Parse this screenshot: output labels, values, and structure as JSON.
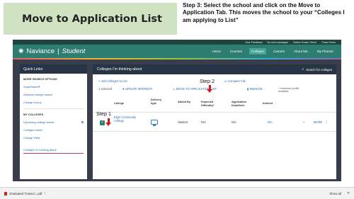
{
  "slide": {
    "title": "Move to Application List",
    "instruction": "Step 3: Select the school and click on the Move to Application Tab. This moves the school to your “Colleges I am applying to List”",
    "step1_label": "Step 1",
    "step2_label": "Step 2"
  },
  "utility_bar": {
    "feedback": "Give Feedback",
    "messages": "No new messages",
    "switch_grade": "Switch Grade: Demo",
    "close_demo": "Close Demo"
  },
  "navbar": {
    "brand": "Naviance",
    "product": "Student",
    "links": [
      "Home",
      "Courses",
      "Colleges",
      "Careers",
      "About Me",
      "My Planner"
    ],
    "active_link": "Colleges"
  },
  "sidebar": {
    "title": "Quick Links",
    "more_search_heading": "MORE SEARCH OPTIONS",
    "search_items": [
      "SuperMatch®",
      "Advance college search",
      "College lookup"
    ],
    "my_colleges_heading": "MY COLLEGES",
    "college_items": [
      "Upcoming college events",
      "Colleges match",
      "College Visits",
      "Colleges I'm thinking about"
    ]
  },
  "main": {
    "title": "Colleges I'm thinking about",
    "search_label": "Search for colleges",
    "add_link": "+ Add Colleges to List",
    "compare_link": "Compare File",
    "selected_text": "1 selected",
    "update_interest": "UPDATE INTEREST",
    "move_to_app": "MOVE TO APPLICATION LIST",
    "remove": "REMOVE",
    "extended_profile": "+ extended profile available",
    "columns": [
      "College",
      "Delivery type",
      "Added By",
      "Expected Difficulty*",
      "Application Deadlines",
      "Interest"
    ],
    "row": {
      "college": "Elgin Community College",
      "added_by": "Student",
      "difficulty": "N/A",
      "deadline": "N/A",
      "interest": "N/A",
      "more": "MORE"
    }
  },
  "downloads": {
    "file": "Graduated Transcri...pdf",
    "show_all": "Show all"
  }
}
